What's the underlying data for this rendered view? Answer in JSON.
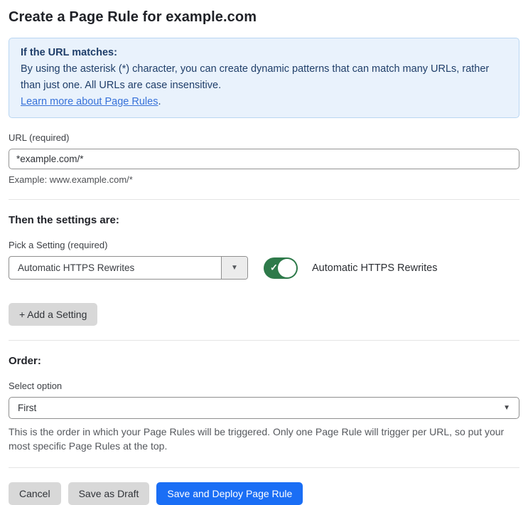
{
  "page": {
    "title": "Create a Page Rule for example.com"
  },
  "info_box": {
    "heading": "If the URL matches:",
    "description": "By using the asterisk (*) character, you can create dynamic patterns that can match many URLs, rather than just one. All URLs are case insensitive.",
    "link_label": "Learn more about Page Rules",
    "link_suffix": "."
  },
  "url_field": {
    "label": "URL (required)",
    "value": "*example.com/*",
    "helper": "Example: www.example.com/*"
  },
  "settings_section": {
    "heading": "Then the settings are:",
    "picker_label": "Pick a Setting (required)",
    "selected_setting": "Automatic HTTPS Rewrites",
    "toggle_label": "Automatic HTTPS Rewrites",
    "toggle_state": "on",
    "add_setting_label": "+ Add a Setting"
  },
  "order_section": {
    "heading": "Order:",
    "select_label": "Select option",
    "selected_option": "First",
    "help_text": "This is the order in which your Page Rules will be triggered. Only one Page Rule will trigger per URL, so put your most specific Page Rules at the top."
  },
  "footer": {
    "cancel_label": "Cancel",
    "save_draft_label": "Save as Draft",
    "save_deploy_label": "Save and Deploy Page Rule"
  },
  "icons": {
    "caret_down": "▼",
    "check": "✓"
  },
  "colors": {
    "accent_blue": "#1a6ef5",
    "toggle_green": "#2e7a4a",
    "info_background": "#e9f2fc",
    "info_border": "#b9d6f2",
    "info_text": "#1f3e69",
    "link_blue": "#3671d9",
    "button_gray": "#d8d8d8"
  }
}
